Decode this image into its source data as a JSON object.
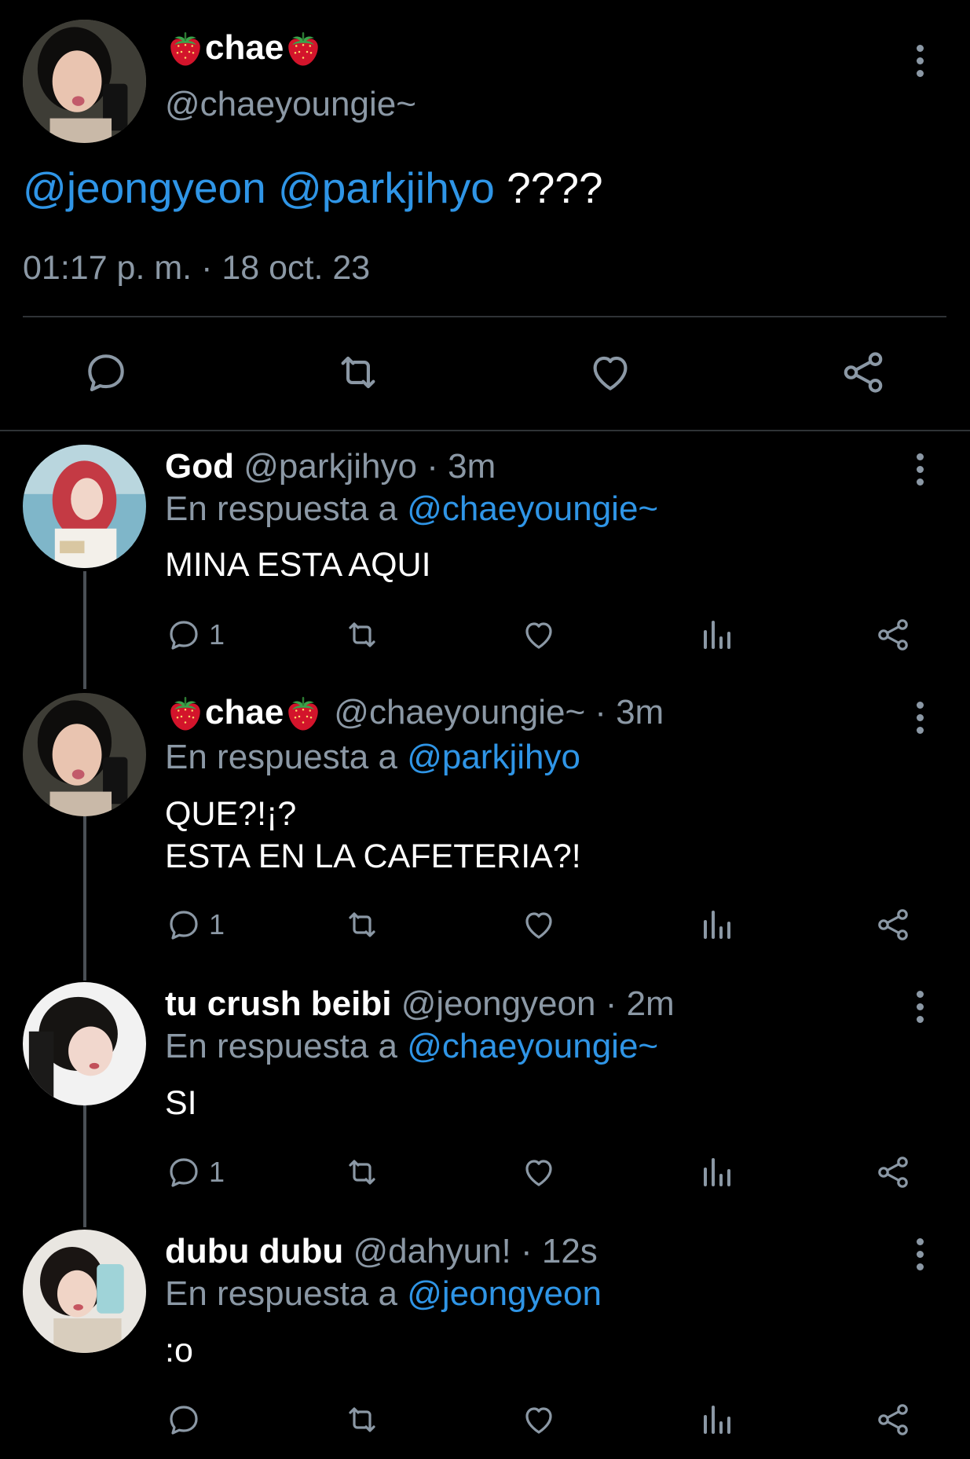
{
  "main_tweet": {
    "display_name": "chae",
    "emoji": "🍓",
    "handle": "@chaeyoungie~",
    "mentions": [
      "@jeongyeon",
      "@parkjihyo"
    ],
    "text": " ????",
    "timestamp": "01:17 p. m. · 18 oct. 23",
    "actions": [
      "reply",
      "retweet",
      "like",
      "share"
    ]
  },
  "replies": [
    {
      "display_name": "God",
      "handle": "@parkjihyo",
      "time": "· 3m",
      "reply_prefix": "En respuesta a",
      "reply_to": "@chaeyoungie~",
      "text_lines": [
        "MINA ESTA AQUI"
      ],
      "reply_count": "1"
    },
    {
      "display_name": "chae",
      "emoji": "🍓",
      "handle": "@chaeyoungie~",
      "time": "· 3m",
      "reply_prefix": "En respuesta a",
      "reply_to": "@parkjihyo",
      "text_lines": [
        "QUE?!¡?",
        "ESTA EN LA CAFETERIA?!"
      ],
      "reply_count": "1"
    },
    {
      "display_name": "tu crush beibi",
      "handle": "@jeongyeon",
      "time": "· 2m",
      "reply_prefix": "En respuesta a",
      "reply_to": "@chaeyoungie~",
      "text_lines": [
        "SI"
      ],
      "reply_count": "1"
    },
    {
      "display_name": "dubu dubu",
      "handle": "@dahyun!",
      "time": "· 12s",
      "reply_prefix": "En respuesta a",
      "reply_to": "@jeongyeon",
      "text_lines": [
        ":o"
      ],
      "reply_count": ""
    }
  ],
  "colors": {
    "background": "#000000",
    "link": "#2f95e6",
    "muted": "#8b98a5",
    "text": "#ffffff"
  },
  "icons": [
    "reply-icon",
    "retweet-icon",
    "like-icon",
    "analytics-icon",
    "share-icon",
    "more-options-icon",
    "strawberry-emoji"
  ]
}
